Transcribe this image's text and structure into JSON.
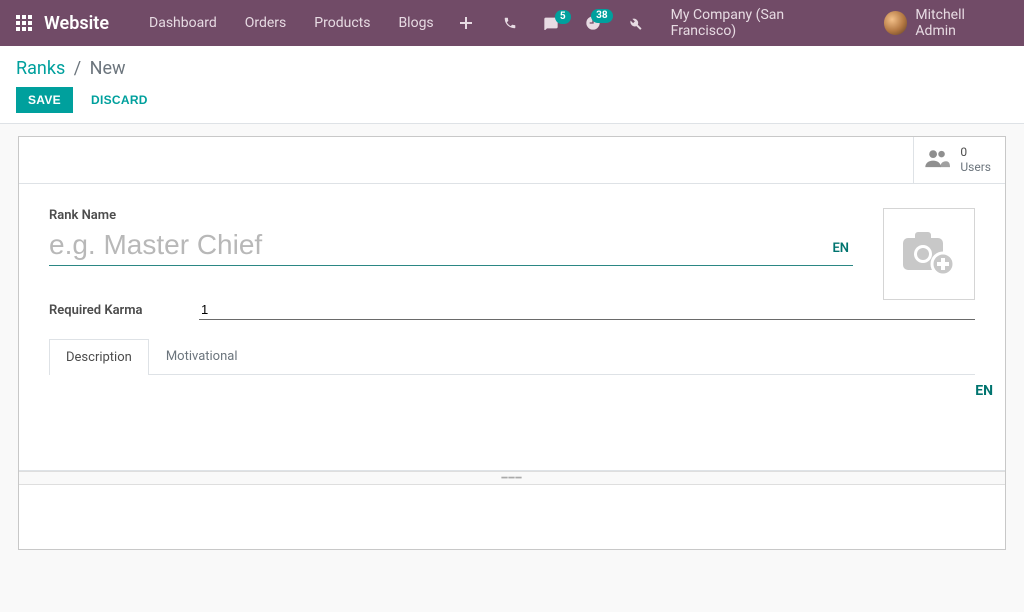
{
  "navbar": {
    "brand": "Website",
    "items": [
      "Dashboard",
      "Orders",
      "Products",
      "Blogs"
    ],
    "chat_badge": "5",
    "clock_badge": "38",
    "company": "My Company (San Francisco)",
    "user": "Mitchell Admin"
  },
  "breadcrumb": {
    "root": "Ranks",
    "sep": "/",
    "current": "New"
  },
  "buttons": {
    "save": "SAVE",
    "discard": "DISCARD"
  },
  "stat": {
    "value": "0",
    "label": "Users"
  },
  "form": {
    "rank_name_label": "Rank Name",
    "rank_name_placeholder": "e.g. Master Chief",
    "rank_name_value": "",
    "lang": "EN",
    "required_karma_label": "Required Karma",
    "required_karma_value": "1",
    "tabs": {
      "description": "Description",
      "motivational": "Motivational"
    },
    "tab_lang": "EN"
  }
}
